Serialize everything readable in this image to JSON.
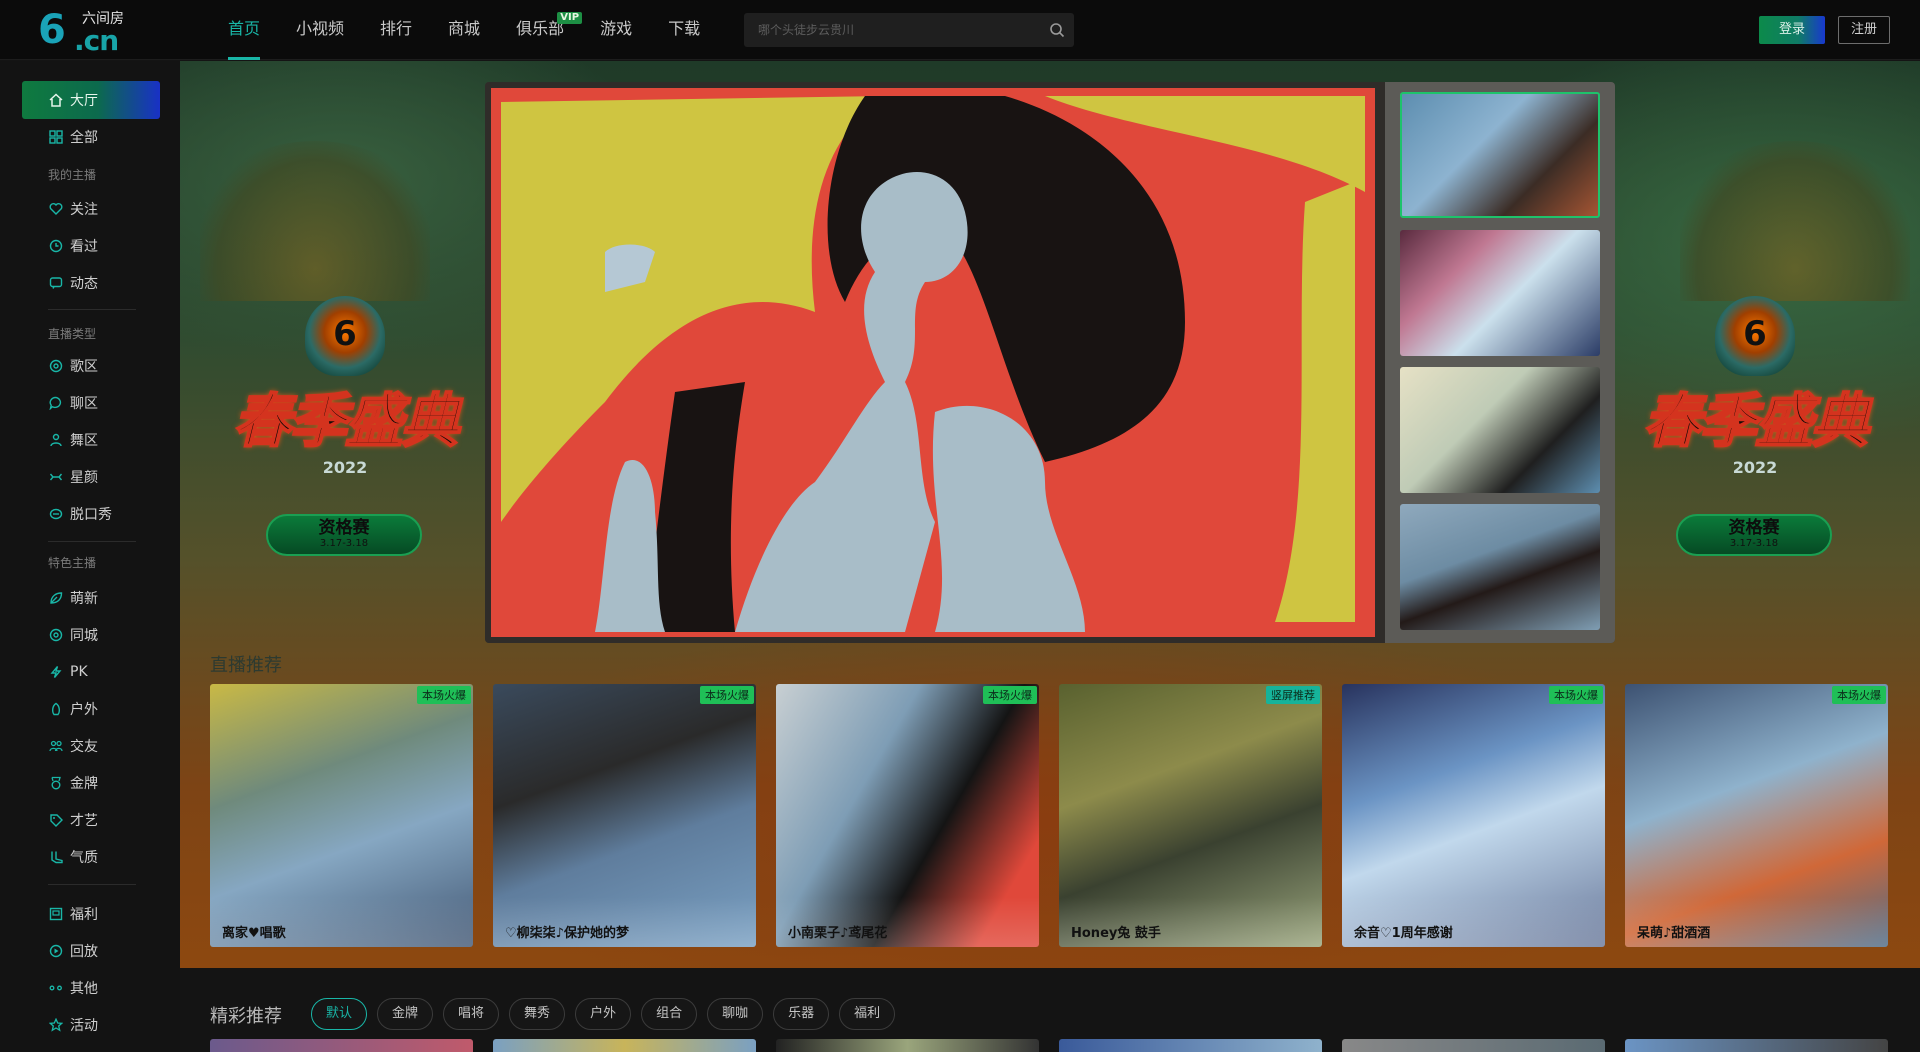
{
  "header": {
    "logo_mark": "6",
    "logo_brand": "六间房",
    "logo_domain": ".cn",
    "nav": [
      {
        "label": "首页",
        "active": true
      },
      {
        "label": "小视频"
      },
      {
        "label": "排行"
      },
      {
        "label": "商城"
      },
      {
        "label": "俱乐部",
        "badge": "VIP"
      },
      {
        "label": "游戏"
      },
      {
        "label": "下载"
      }
    ],
    "search": {
      "placeholder": "哪个头徒步云贵川",
      "icon": "search-icon"
    },
    "login_label": "登录",
    "register_label": "注册"
  },
  "sidebar": {
    "primary": {
      "label": "大厅",
      "icon": "home-icon"
    },
    "all": {
      "label": "全部",
      "icon": "grid-icon"
    },
    "sections": [
      {
        "title": "我的主播",
        "items": [
          {
            "label": "关注",
            "icon": "heart-icon"
          },
          {
            "label": "看过",
            "icon": "clock-icon"
          },
          {
            "label": "动态",
            "icon": "message-icon"
          }
        ]
      },
      {
        "title": "直播类型",
        "items": [
          {
            "label": "歌区",
            "icon": "music-icon"
          },
          {
            "label": "聊区",
            "icon": "chat-icon"
          },
          {
            "label": "舞区",
            "icon": "dance-icon"
          },
          {
            "label": "星颜",
            "icon": "star-face-icon"
          },
          {
            "label": "脱口秀",
            "icon": "mic-icon"
          }
        ]
      },
      {
        "title": "特色主播",
        "items": [
          {
            "label": "萌新",
            "icon": "leaf-icon"
          },
          {
            "label": "同城",
            "icon": "location-icon"
          },
          {
            "label": "PK",
            "icon": "bolt-icon"
          },
          {
            "label": "户外",
            "icon": "mountain-icon"
          },
          {
            "label": "交友",
            "icon": "users-icon"
          },
          {
            "label": "金牌",
            "icon": "medal-icon"
          },
          {
            "label": "才艺",
            "icon": "palette-icon"
          },
          {
            "label": "气质",
            "icon": "boot-icon"
          }
        ]
      }
    ],
    "extras": [
      {
        "label": "福利",
        "icon": "gift-icon"
      },
      {
        "label": "回放",
        "icon": "replay-icon"
      },
      {
        "label": "其他",
        "icon": "more-icon"
      },
      {
        "label": "活动",
        "icon": "star-icon"
      }
    ]
  },
  "hero": {
    "banner": {
      "emblem": "6",
      "title": "春季盛典",
      "year": "2022",
      "pill_name": "资格赛",
      "pill_date": "3.17-3.18"
    }
  },
  "recommend_title": "直播推荐",
  "cards": [
    {
      "tag": "本场火爆",
      "name": "离家♥唱歌"
    },
    {
      "tag": "本场火爆",
      "name": "♡柳柒柒♪保护她的梦"
    },
    {
      "tag": "本场火爆",
      "name": "小南栗子♪鸢尾花"
    },
    {
      "tag": "竖屏推荐",
      "name": "Honey兔 鼓手"
    },
    {
      "tag": "本场火爆",
      "name": "余音♡1周年感谢"
    },
    {
      "tag": "本场火爆",
      "name": "呆萌♪甜酒酒"
    }
  ],
  "featured": {
    "title": "精彩推荐",
    "filters": [
      "默认",
      "金牌",
      "唱将",
      "舞秀",
      "户外",
      "组合",
      "聊咖",
      "乐器",
      "福利"
    ],
    "active_filter": "默认"
  },
  "colors": {
    "accent": "#19b6a7",
    "tag_green": "#1fbf57",
    "login_start": "#0c8a4a",
    "login_end": "#1838cf"
  }
}
